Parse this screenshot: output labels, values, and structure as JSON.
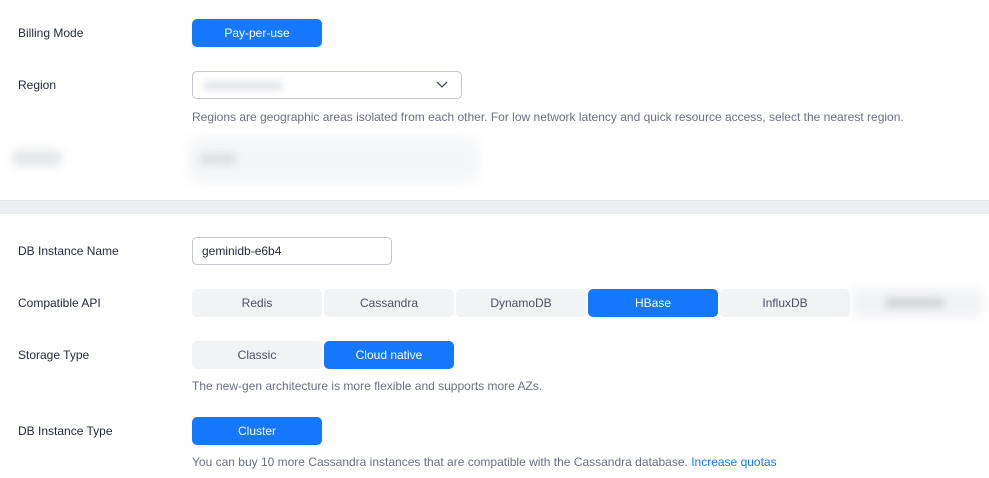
{
  "billing": {
    "label": "Billing Mode",
    "button": "Pay-per-use"
  },
  "region": {
    "label": "Region",
    "value": "",
    "hint": "Regions are geographic areas isolated from each other. For low network latency and quick resource access, select the nearest region."
  },
  "instance_name": {
    "label": "DB Instance Name",
    "value": "geminidb-e6b4"
  },
  "compatible_api": {
    "label": "Compatible API",
    "options": [
      "Redis",
      "Cassandra",
      "DynamoDB",
      "HBase",
      "InfluxDB"
    ],
    "selected": "HBase"
  },
  "storage_type": {
    "label": "Storage Type",
    "options": [
      "Classic",
      "Cloud native"
    ],
    "selected": "Cloud native",
    "hint": "The new-gen architecture is more flexible and supports more AZs."
  },
  "instance_type": {
    "label": "DB Instance Type",
    "button": "Cluster",
    "hint": "You can buy 10 more Cassandra instances that are compatible with the Cassandra database.",
    "link": "Increase quotas"
  },
  "colors": {
    "primary": "#1677ff",
    "segment_bg": "#f2f3f5",
    "divider": "#eceef1"
  }
}
